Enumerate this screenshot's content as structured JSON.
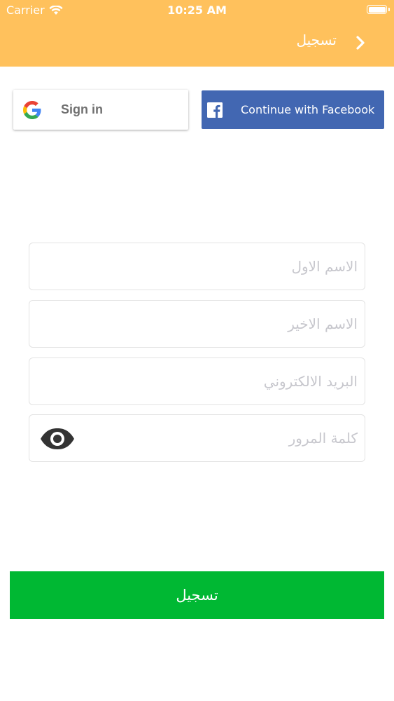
{
  "status_bar": {
    "carrier": "Carrier",
    "time": "10:25 AM"
  },
  "header": {
    "title": "تسجيل",
    "background_color": "#ffc15c"
  },
  "social": {
    "google_label": "Sign in",
    "facebook_label": "Continue with Facebook",
    "facebook_color": "#4267b2"
  },
  "form": {
    "first_name_placeholder": "الاسم الاول",
    "last_name_placeholder": "الاسم الاخير",
    "email_placeholder": "البريد الالكتروني",
    "password_placeholder": "كلمة المرور"
  },
  "register_button": {
    "label": "تسجيل",
    "color": "#00b833"
  },
  "icons": {
    "back": "chevron-right-icon",
    "google": "google-logo-icon",
    "facebook": "facebook-logo-icon",
    "password_visibility": "eye-icon"
  }
}
